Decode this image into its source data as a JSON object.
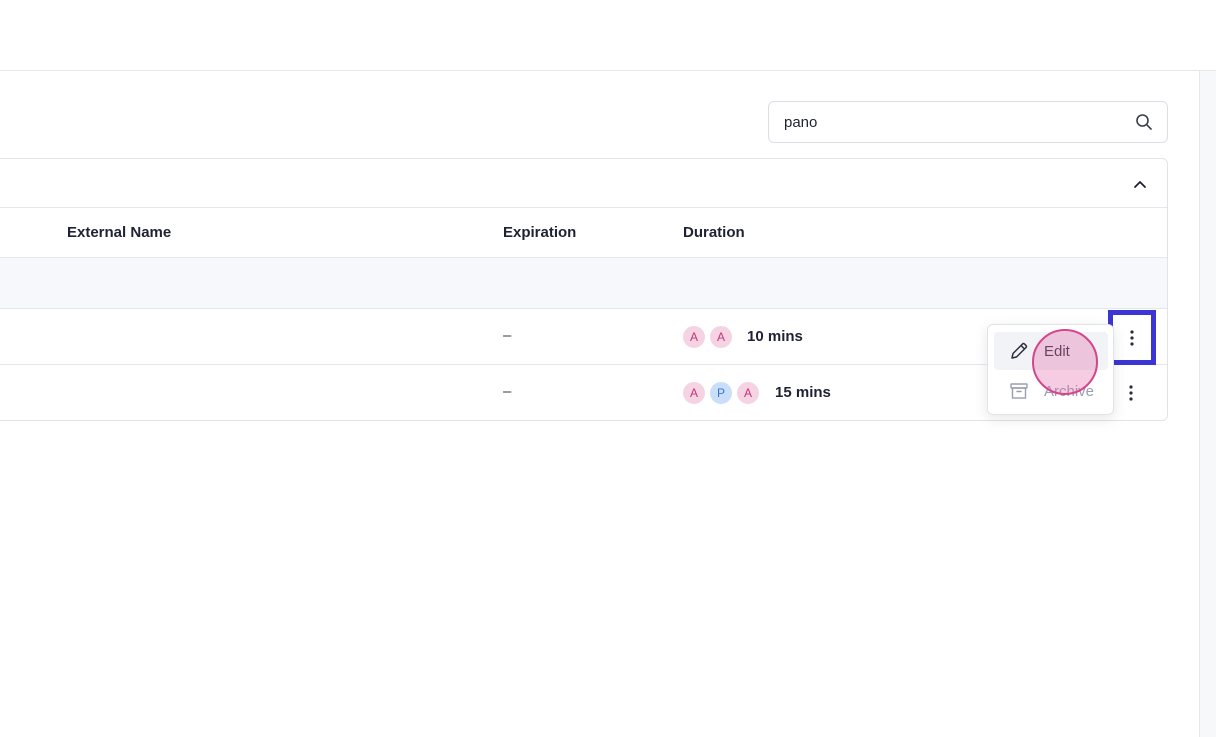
{
  "search": {
    "value": "pano"
  },
  "table": {
    "columns": {
      "external_name": "External Name",
      "expiration": "Expiration",
      "duration": "Duration"
    },
    "rows": [
      {
        "expiration": "–",
        "avatars": [
          "A",
          "A"
        ],
        "duration": "10 mins"
      },
      {
        "expiration": "–",
        "avatars": [
          "A",
          "P",
          "A"
        ],
        "duration": "15 mins"
      }
    ]
  },
  "menu": {
    "edit_label": "Edit",
    "archive_label": "Archive"
  },
  "colors": {
    "highlight": "#3b35d4",
    "click_marker": "#d4458c",
    "avatar_pink": "#f6d3e3",
    "avatar_blue": "#c9def8"
  }
}
